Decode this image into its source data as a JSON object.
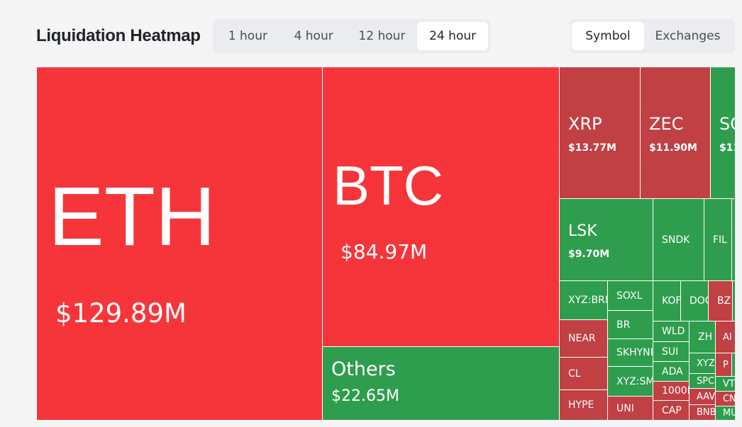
{
  "header": {
    "title": "Liquidation Heatmap"
  },
  "time_tabs": [
    {
      "label": "1 hour",
      "active": false
    },
    {
      "label": "4 hour",
      "active": false
    },
    {
      "label": "12 hour",
      "active": false
    },
    {
      "label": "24 hour",
      "active": true
    }
  ],
  "view_tabs": [
    {
      "label": "Symbol",
      "active": true
    },
    {
      "label": "Exchanges",
      "active": false
    }
  ],
  "colors": {
    "red_main": "#f6353a",
    "red_dark": "#c04044",
    "green": "#2e9d4e",
    "tab_active_bg": "#ffffff",
    "tab_bg": "#eaecef"
  },
  "tiles": {
    "eth": {
      "symbol": "ETH",
      "value": "$129.89M"
    },
    "btc": {
      "symbol": "BTC",
      "value": "$84.97M"
    },
    "others": {
      "symbol": "Others",
      "value": "$22.65M"
    },
    "xrp": {
      "symbol": "XRP",
      "value": "$13.77M"
    },
    "zec": {
      "symbol": "ZEC",
      "value": "$11.90M"
    },
    "sol": {
      "symbol": "SO",
      "value": "$11"
    },
    "lsk": {
      "symbol": "LSK",
      "value": "$9.70M"
    },
    "sndk": {
      "symbol": "SNDK"
    },
    "fil": {
      "symbol": "FIL"
    },
    "xyzbr": {
      "symbol": "XYZ:BRI"
    },
    "soxl": {
      "symbol": "SOXL"
    },
    "kor": {
      "symbol": "KOF"
    },
    "doc": {
      "symbol": "DOC"
    },
    "bz": {
      "symbol": "BZ"
    },
    "near": {
      "symbol": "NEAR"
    },
    "br": {
      "symbol": "BR"
    },
    "wld": {
      "symbol": "WLD"
    },
    "zh": {
      "symbol": "ZH"
    },
    "ai": {
      "symbol": "AI"
    },
    "skhyni": {
      "symbol": "SKHYNI"
    },
    "sui": {
      "symbol": "SUI"
    },
    "xyz2": {
      "symbol": "XYZ"
    },
    "p": {
      "symbol": "P"
    },
    "cl": {
      "symbol": "CL"
    },
    "ada": {
      "symbol": "ADA"
    },
    "spc": {
      "symbol": "SPC"
    },
    "vt": {
      "symbol": "VT"
    },
    "xyzsm": {
      "symbol": "XYZ:SM"
    },
    "k1000": {
      "symbol": "1000K"
    },
    "aav": {
      "symbol": "AAV"
    },
    "cn": {
      "symbol": "CN"
    },
    "hype": {
      "symbol": "HYPE"
    },
    "uni": {
      "symbol": "UNI"
    },
    "cap": {
      "symbol": "CAP"
    },
    "bnb": {
      "symbol": "BNB"
    },
    "mu": {
      "symbol": "MU"
    }
  }
}
